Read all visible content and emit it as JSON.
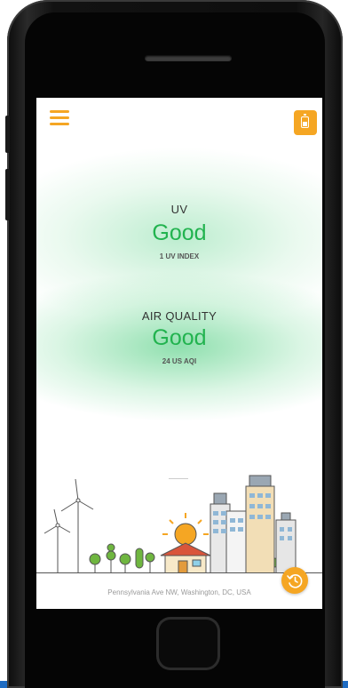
{
  "device": {
    "accent_color": "#f5a623",
    "good_color": "#22b34f",
    "ground_color": "#6c9c2f"
  },
  "header": {
    "menu_icon": "hamburger-menu-icon",
    "battery_icon": "battery-icon"
  },
  "uv": {
    "title": "UV",
    "status": "Good",
    "index": "1 UV INDEX"
  },
  "air_quality": {
    "title": "AIR QUALITY",
    "status": "Good",
    "index": "24 US AQI"
  },
  "footer": {
    "address": "Pennsylvania Ave NW, Washington, DC, USA",
    "history_icon": "history-clock-icon"
  }
}
